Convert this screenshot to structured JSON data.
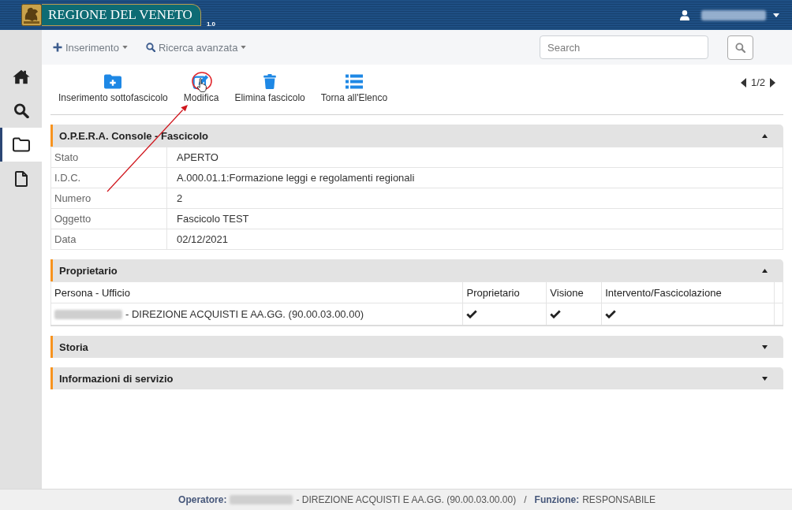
{
  "header": {
    "logo_text": "REGIONE DEL VENETO",
    "version": "1.0"
  },
  "sidebar": {
    "items": [
      {
        "selected": false
      },
      {
        "selected": false
      },
      {
        "selected": true
      },
      {
        "selected": false
      }
    ]
  },
  "navbar": {
    "menus": [
      {
        "label": "Inserimento"
      },
      {
        "label": "Ricerca avanzata"
      }
    ],
    "search": {
      "placeholder": "Search"
    }
  },
  "toolbar": {
    "actions": [
      {
        "label": "Inserimento sottofascicolo"
      },
      {
        "label": "Modifica"
      },
      {
        "label": "Elimina fascicolo"
      },
      {
        "label": "Torna all'Elenco"
      }
    ],
    "pager": "1/2"
  },
  "panels": [
    {
      "title": "O.P.E.R.A. Console - Fascicolo",
      "expanded": true,
      "kind": "fields",
      "fields": [
        {
          "label": "Stato",
          "value": "APERTO"
        },
        {
          "label": "I.D.C.",
          "value": "A.000.01.1:Formazione leggi e regolamenti regionali"
        },
        {
          "label": "Numero",
          "value": "2"
        },
        {
          "label": "Oggetto",
          "value": "Fascicolo TEST"
        },
        {
          "label": "Data",
          "value": "02/12/2021"
        }
      ]
    },
    {
      "title": "Proprietario",
      "expanded": true,
      "kind": "table",
      "columns": [
        "Persona - Ufficio",
        "Proprietario",
        "Visione",
        "Intervento/Fascicolazione"
      ],
      "rows": [
        {
          "office": "- DIREZIONE ACQUISTI E AA.GG. (90.00.03.00.00)",
          "flags": [
            {
              "checked": true
            },
            {
              "checked": true
            },
            {
              "checked": true
            }
          ]
        }
      ]
    },
    {
      "title": "Storia",
      "expanded": false
    },
    {
      "title": "Informazioni di servizio",
      "expanded": false
    }
  ],
  "footer": {
    "operator_label": "Operatore:",
    "office": "- DIREZIONE ACQUISTI E AA.GG. (90.00.03.00.00)",
    "separator": "/",
    "role_label": "Funzione:",
    "role": "RESPONSABILE"
  }
}
